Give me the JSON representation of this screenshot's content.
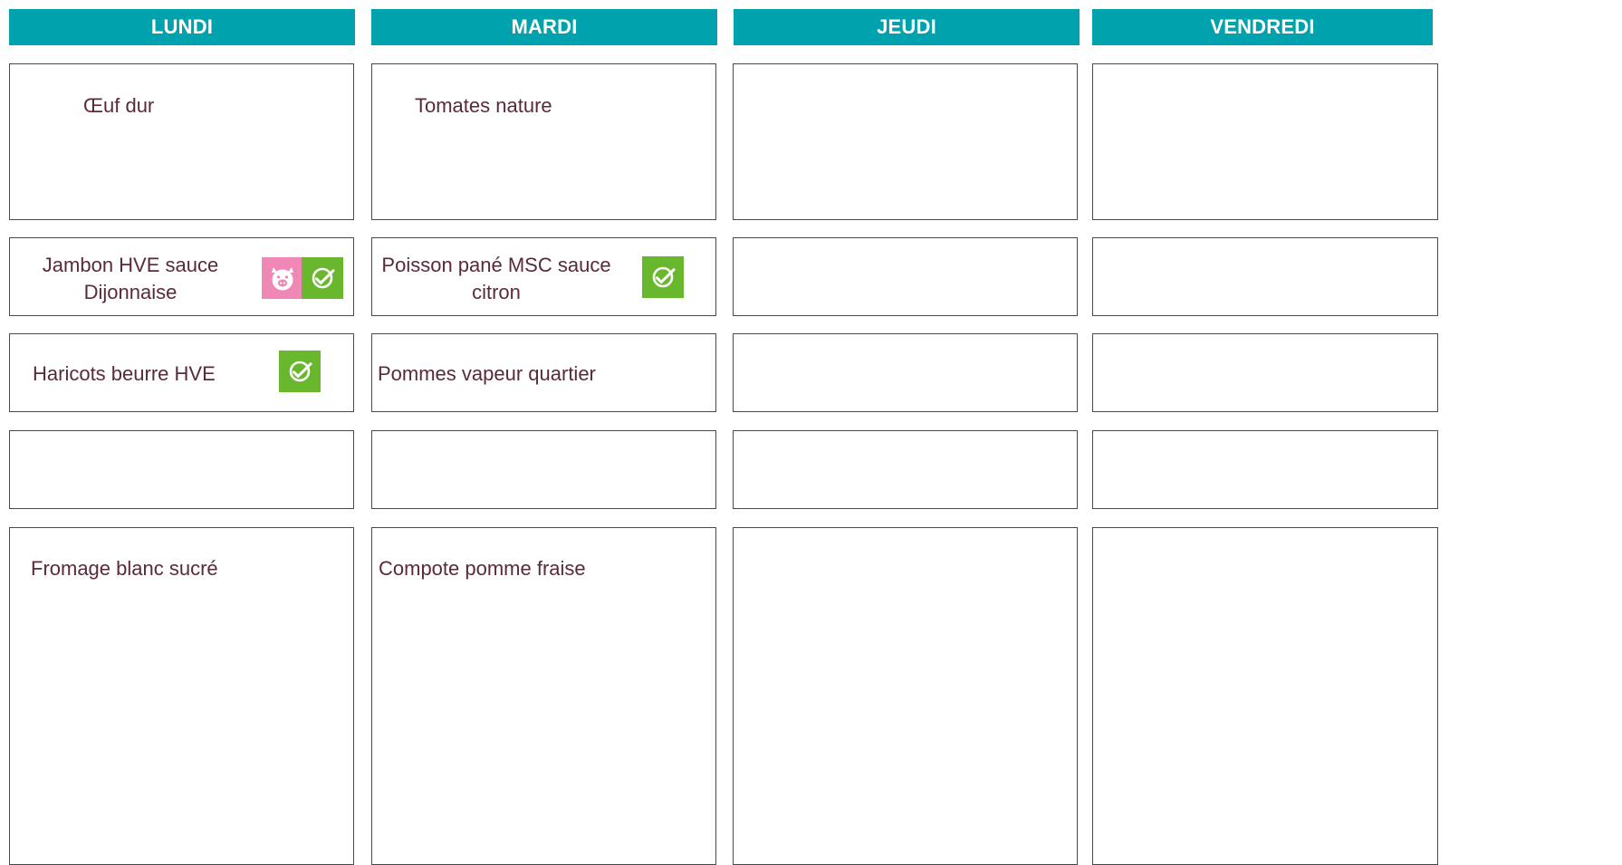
{
  "days": [
    {
      "name": "LUNDI",
      "rows": [
        {
          "lines": [
            "Œuf dur"
          ],
          "badges": []
        },
        {
          "lines": [
            "Jambon HVE sauce",
            "Dijonnaise"
          ],
          "badges": [
            "pig-icon",
            "check-icon"
          ]
        },
        {
          "lines": [
            "Haricots beurre HVE"
          ],
          "badges": [
            "check-icon"
          ]
        },
        {
          "lines": [],
          "badges": []
        },
        {
          "lines": [
            "Fromage blanc sucré"
          ],
          "badges": []
        }
      ]
    },
    {
      "name": "MARDI",
      "rows": [
        {
          "lines": [
            "Tomates nature"
          ],
          "badges": []
        },
        {
          "lines": [
            "Poisson pané MSC sauce",
            "citron"
          ],
          "badges": [
            "check-icon"
          ]
        },
        {
          "lines": [
            "Pommes vapeur quartier"
          ],
          "badges": []
        },
        {
          "lines": [],
          "badges": []
        },
        {
          "lines": [
            "Compote pomme fraise"
          ],
          "badges": []
        }
      ]
    },
    {
      "name": "JEUDI",
      "rows": [
        {
          "lines": [],
          "badges": []
        },
        {
          "lines": [],
          "badges": []
        },
        {
          "lines": [],
          "badges": []
        },
        {
          "lines": [],
          "badges": []
        },
        {
          "lines": [],
          "badges": []
        }
      ]
    },
    {
      "name": "VENDREDI",
      "rows": [
        {
          "lines": [],
          "badges": []
        },
        {
          "lines": [],
          "badges": []
        },
        {
          "lines": [],
          "badges": []
        },
        {
          "lines": [],
          "badges": []
        },
        {
          "lines": [],
          "badges": []
        }
      ]
    }
  ],
  "colors": {
    "header_bg": "#00a3ad",
    "header_text": "#ffffff",
    "item_text": "#5a2a3a",
    "pig_badge": "#ef87b7",
    "check_badge": "#69b72d"
  }
}
